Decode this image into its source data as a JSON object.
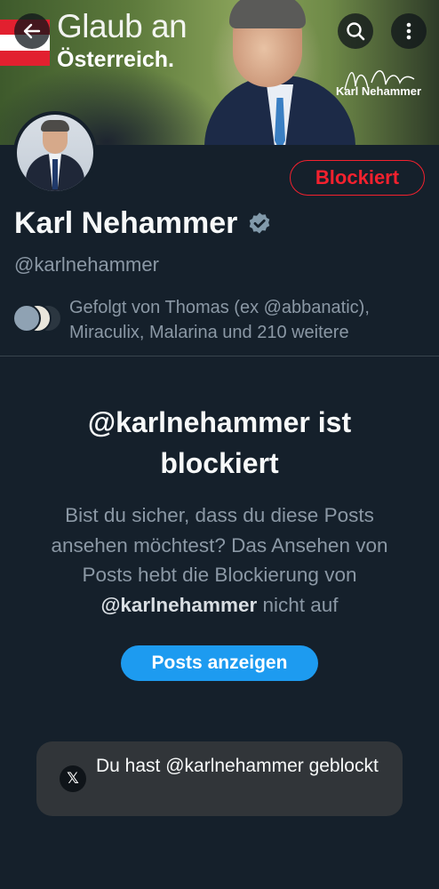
{
  "header": {
    "banner_title": "Glaub an",
    "banner_subtitle": "Österreich.",
    "banner_signature": "Karl Nehammer"
  },
  "profile": {
    "name": "Karl Nehammer",
    "handle": "@karlnehammer",
    "verified": true,
    "block_status_label": "Blockiert",
    "followed_by": "Gefolgt von Thomas (ex @abbanatic), Miraculix, Malarina und 210 weitere"
  },
  "blocked_notice": {
    "title": "@karlnehammer ist blockiert",
    "body_prefix": "Bist du sicher, dass du diese Posts ansehen möchtest? Das Ansehen von Posts hebt die Blockierung von ",
    "body_handle": "@karlnehammer",
    "body_suffix": " nicht auf",
    "show_posts_label": "Posts anzeigen"
  },
  "toast": {
    "icon_text": "𝕏",
    "message": "Du hast @karlnehammer geblockt"
  },
  "icons": {
    "back": "back-arrow-icon",
    "search": "search-icon",
    "more": "more-vertical-icon",
    "verified": "verified-badge-icon"
  },
  "colors": {
    "background": "#15202b",
    "blocked": "#f4212e",
    "accent": "#1d9bf0",
    "muted_text": "#8b98a5"
  }
}
